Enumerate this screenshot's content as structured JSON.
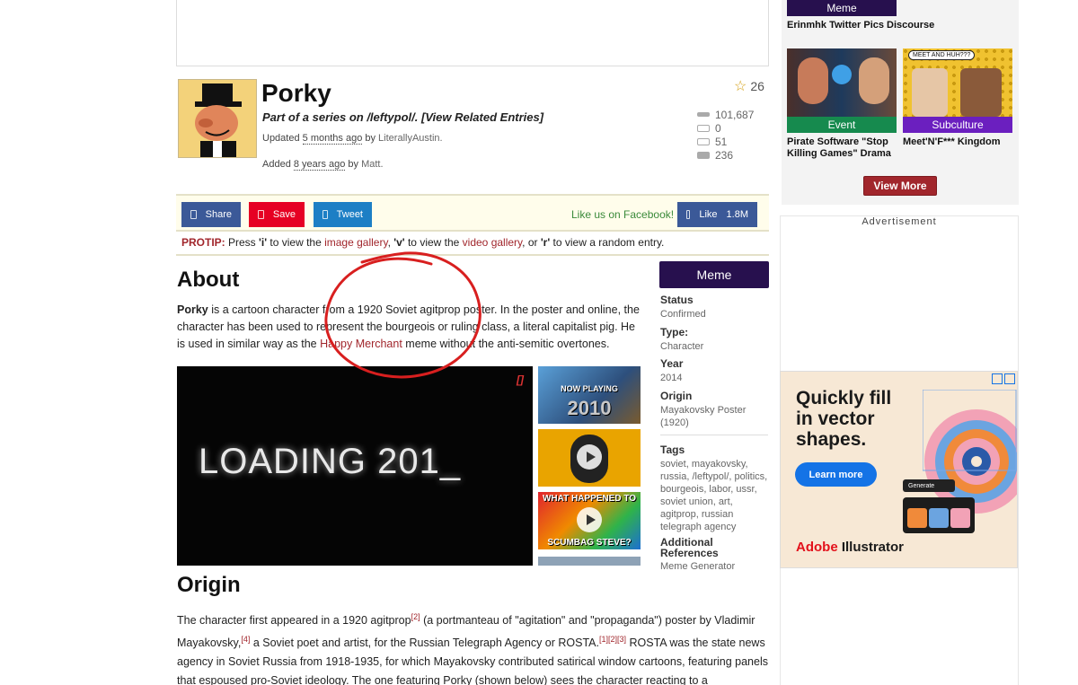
{
  "entry": {
    "title": "Porky",
    "series": "Part of a series on /leftypol/. [View Related Entries]",
    "updated_prefix": "Updated ",
    "updated_when": "5 months ago",
    "updated_by_prefix": " by ",
    "updated_by": "LiterallyAustin.",
    "added_prefix": "Added ",
    "added_when": "8 years ago",
    "added_by_prefix": " by ",
    "added_by": "Matt.",
    "favorites": "26",
    "stats": {
      "views": "101,687",
      "videos": "0",
      "images": "51",
      "comments": "236"
    }
  },
  "share_bar": {
    "share": "Share",
    "save": "Save",
    "tweet": "Tweet",
    "like_us": "Like us on Facebook!",
    "like": "Like",
    "like_count": "1.8M",
    "colors": {
      "share": "#3b5998",
      "save": "#e60023",
      "tweet": "#1d7fc5",
      "like": "#3b5998"
    }
  },
  "protip": {
    "label": "PROTIP:",
    "t1": " Press ",
    "k1": "'i'",
    "t2": " to view the ",
    "l1": "image gallery",
    "t3": ", ",
    "k2": "'v'",
    "t4": " to view the ",
    "l2": "video gallery",
    "t5": ", or ",
    "k3": "'r'",
    "t6": " to view a random entry."
  },
  "about": {
    "heading": "About",
    "bold": "Porky",
    "text1": " is a cartoon character from a 1920 Soviet agitprop poster. In the poster and online, the character has been used to represent the bourgeois or ruling class, a literal capitalist pig. He is used in similar way as the ",
    "link": "Happy Merchant",
    "text2": " meme without the anti-semitic overtones."
  },
  "video": {
    "loading_text": "LOADING 201_",
    "bracket": "[]",
    "thumb1_caption_top": "NOW PLAYING",
    "thumb1_caption_year": "2010",
    "thumb3_caption_top": "WHAT HAPPENED TO",
    "thumb3_caption_bottom": "SCUMBAG STEVE?"
  },
  "origin": {
    "heading": "Origin",
    "p1": "The character first appeared in a 1920 agitprop",
    "r1": "[2]",
    "p2": " (a portmanteau of \"agitation\" and \"propaganda\") poster by Vladimir Mayakovsky,",
    "r2": "[4]",
    "p3": " a Soviet poet and artist, for the Russian Telegraph Agency or ROSTA.",
    "r3": "[1][2][3]",
    "p4": " ROSTA was the state news agency in Soviet Russia from 1918-1935, for which Mayakovsky contributed satirical window cartoons, featuring panels that espoused pro-Soviet ideology. The one featuring Porky (shown below) sees the character reacting to a"
  },
  "details": {
    "badge": "Meme",
    "status_k": "Status",
    "status_v": "Confirmed",
    "type_k": "Type:",
    "type_v": "Character",
    "year_k": "Year",
    "year_v": "2014",
    "origin_k": "Origin",
    "origin_v": "Mayakovsky Poster (1920)",
    "tags_k": "Tags",
    "tags_v": "soviet, mayakovsky, russia, /leftypol/, politics, bourgeois, labor, ussr, soviet union, art, agitprop, russian telegraph agency",
    "refs_k": "Additional References",
    "refs_v": "Meme Generator"
  },
  "sidebar": {
    "top_tile_band": "Meme",
    "top_tile_title": "Erinmhk Twitter Pics Discourse",
    "tile1_band": "Event",
    "tile1_title": "Pirate Software \"Stop Killing Games\" Drama",
    "tile2_band": "Subculture",
    "tile2_title": "Meet'N'F*** Kingdom",
    "tile2_bubble": "MEET AND HUH???",
    "view_more": "View More",
    "advertisement": "Advertisement",
    "band_colors": {
      "meme": "#27104e",
      "event": "#168a4e",
      "subculture": "#6b1fbf"
    }
  },
  "ad": {
    "headline_1": "Quickly fill",
    "headline_2": "in vector",
    "headline_3": "shapes.",
    "button": "Learn more",
    "brand_a": "Adobe",
    "brand_b": " Illustrator",
    "generator": "Generate"
  }
}
